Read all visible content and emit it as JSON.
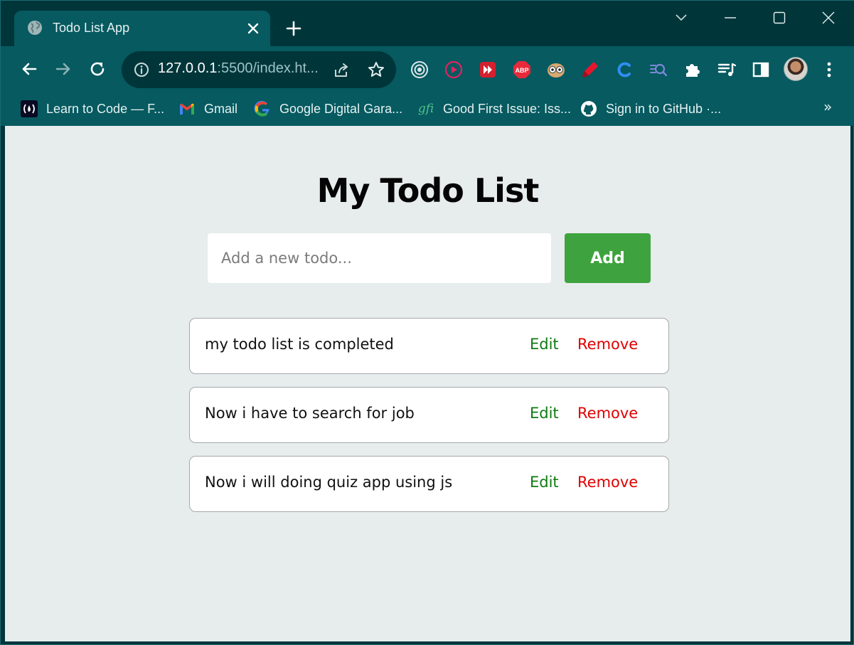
{
  "browser": {
    "tab": {
      "title": "Todo List App",
      "favicon": "globe-icon"
    },
    "address_bar": {
      "host": "127.0.0.1",
      "rest": ":5500/index.ht..."
    },
    "extensions": [
      "record-icon",
      "play-circle-icon",
      "fast-forward-icon",
      "abp-icon",
      "owl-icon",
      "marker-icon",
      "c-logo-icon",
      "search-code-icon",
      "puzzle-icon",
      "media-queue-icon",
      "side-panel-icon"
    ],
    "extension_abp_label": "ABP",
    "bookmarks": [
      {
        "label": "Learn to Code — F...",
        "icon": "freecodecamp-icon"
      },
      {
        "label": "Gmail",
        "icon": "gmail-icon"
      },
      {
        "label": "Google Digital Gara...",
        "icon": "google-icon"
      },
      {
        "label": "Good First Issue: Iss...",
        "icon": "gfi-icon"
      },
      {
        "label": "Sign in to GitHub ·...",
        "icon": "github-icon"
      }
    ],
    "bookmarks_more": "»",
    "gfi_text": "gfi"
  },
  "app": {
    "title": "My Todo List",
    "input": {
      "value": "",
      "placeholder": "Add a new todo..."
    },
    "add_label": "Add",
    "todos": [
      {
        "text": "my todo list is completed",
        "edit_label": "Edit",
        "remove_label": "Remove"
      },
      {
        "text": "Now i have to search for job",
        "edit_label": "Edit",
        "remove_label": "Remove"
      },
      {
        "text": "Now i will doing quiz app using js",
        "edit_label": "Edit",
        "remove_label": "Remove"
      }
    ]
  },
  "colors": {
    "frame": "#00363a",
    "toolbar": "#065a60",
    "page_bg": "#e7eced",
    "add_button": "#3ea33e",
    "edit": "#0f7a12",
    "remove": "#e00000"
  }
}
